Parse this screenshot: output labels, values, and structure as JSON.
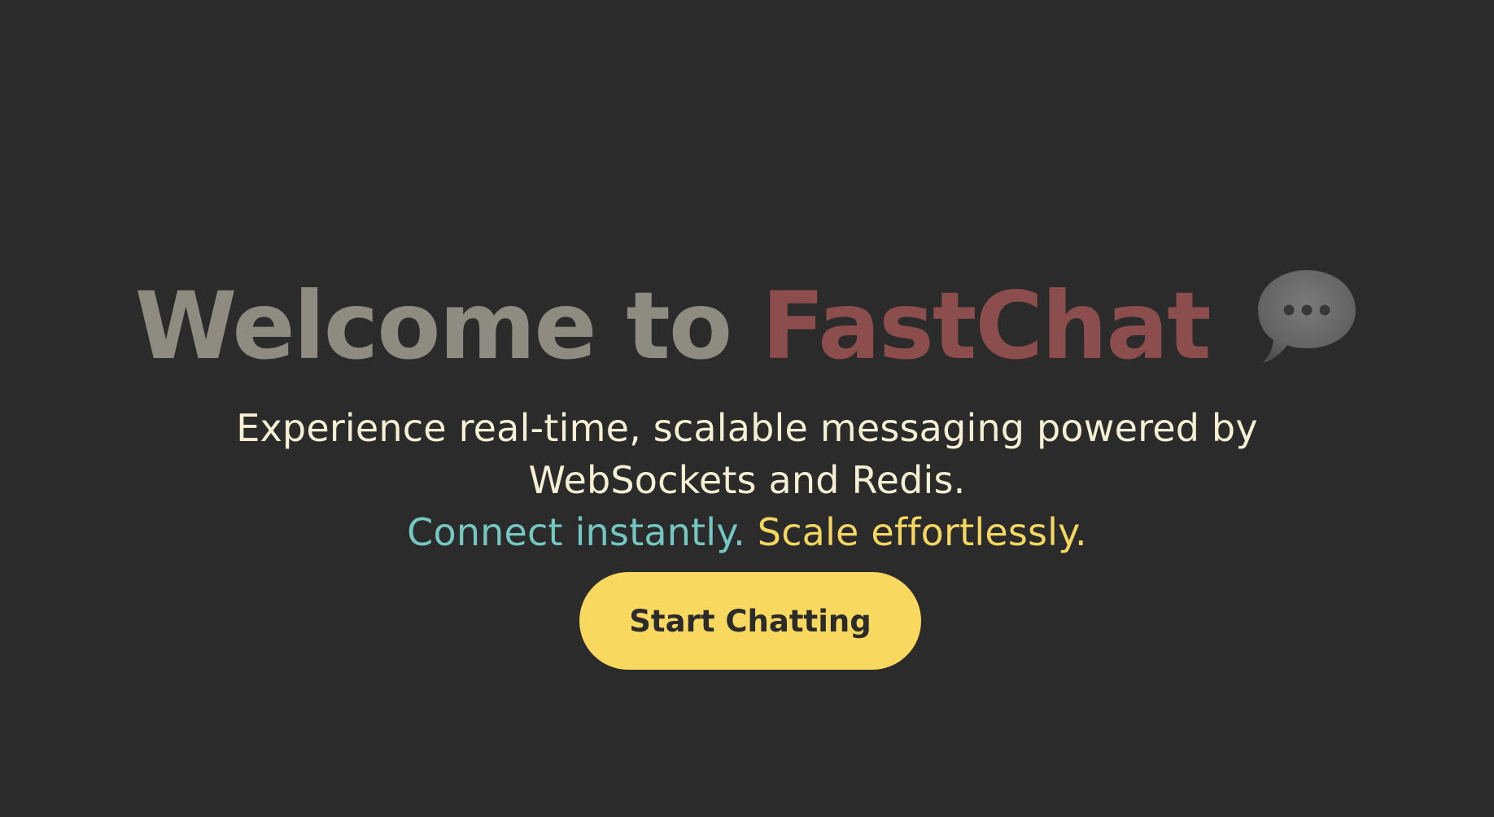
{
  "hero": {
    "title_prefix": "Welcome to",
    "title_brand": "FastChat",
    "title_icon": "speech-bubble-icon",
    "subtitle_line1": "Experience real-time, scalable messaging powered by",
    "subtitle_line2": "WebSockets and Redis.",
    "tagline_connect": "Connect instantly.",
    "tagline_scale": "Scale effortlessly.",
    "cta_label": "Start Chatting"
  },
  "colors": {
    "background": "#2b2b2b",
    "title_prefix": "#8e8b80",
    "title_brand": "#8c4d4d",
    "subtitle": "#f5efd3",
    "tagline_connect": "#75c7c1",
    "tagline_scale": "#f5d660",
    "cta_background": "#f9d85f",
    "cta_text": "#2b2b2b"
  }
}
